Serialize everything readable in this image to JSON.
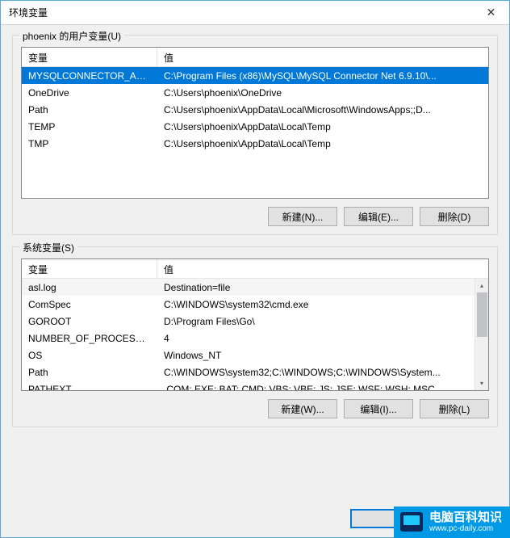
{
  "window": {
    "title": "环境变量",
    "close_icon": "✕"
  },
  "user_group": {
    "label": "phoenix 的用户变量(U)",
    "col_var": "变量",
    "col_val": "值",
    "rows": [
      {
        "name": "MYSQLCONNECTOR_ASS...",
        "value": "C:\\Program Files (x86)\\MySQL\\MySQL Connector Net 6.9.10\\...",
        "selected": true
      },
      {
        "name": "OneDrive",
        "value": "C:\\Users\\phoenix\\OneDrive"
      },
      {
        "name": "Path",
        "value": "C:\\Users\\phoenix\\AppData\\Local\\Microsoft\\WindowsApps;;D..."
      },
      {
        "name": "TEMP",
        "value": "C:\\Users\\phoenix\\AppData\\Local\\Temp"
      },
      {
        "name": "TMP",
        "value": "C:\\Users\\phoenix\\AppData\\Local\\Temp"
      }
    ],
    "buttons": {
      "new": "新建(N)...",
      "edit": "编辑(E)...",
      "delete": "删除(D)"
    }
  },
  "system_group": {
    "label": "系统变量(S)",
    "col_var": "变量",
    "col_val": "值",
    "rows": [
      {
        "name": "asl.log",
        "value": "Destination=file",
        "stripe": true
      },
      {
        "name": "ComSpec",
        "value": "C:\\WINDOWS\\system32\\cmd.exe"
      },
      {
        "name": "GOROOT",
        "value": "D:\\Program Files\\Go\\"
      },
      {
        "name": "NUMBER_OF_PROCESSORS",
        "value": "4"
      },
      {
        "name": "OS",
        "value": "Windows_NT"
      },
      {
        "name": "Path",
        "value": "C:\\WINDOWS\\system32;C:\\WINDOWS;C:\\WINDOWS\\System..."
      },
      {
        "name": "PATHEXT",
        "value": ".COM;.EXE;.BAT;.CMD;.VBS;.VBE;.JS;.JSE;.WSF;.WSH;.MSC"
      }
    ],
    "buttons": {
      "new": "新建(W)...",
      "edit": "编辑(I)...",
      "delete": "删除(L)"
    }
  },
  "dialog_buttons": {
    "ok": "",
    "cancel": ""
  },
  "watermark": {
    "title": "电脑百科知识",
    "url": "www.pc-daily.com"
  }
}
